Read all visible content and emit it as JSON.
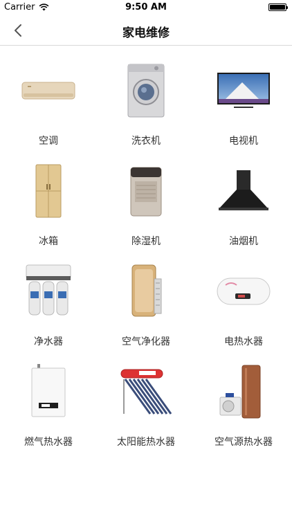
{
  "status": {
    "carrier": "Carrier",
    "time": "9:50 AM"
  },
  "nav": {
    "title": "家电维修",
    "back_icon": "chevron-left-icon"
  },
  "items": [
    {
      "label": "空调",
      "icon": "air-conditioner-icon"
    },
    {
      "label": "洗衣机",
      "icon": "washing-machine-icon"
    },
    {
      "label": "电视机",
      "icon": "television-icon"
    },
    {
      "label": "冰箱",
      "icon": "refrigerator-icon"
    },
    {
      "label": "除湿机",
      "icon": "dehumidifier-icon"
    },
    {
      "label": "油烟机",
      "icon": "range-hood-icon"
    },
    {
      "label": "净水器",
      "icon": "water-purifier-icon"
    },
    {
      "label": "空气净化器",
      "icon": "air-purifier-icon"
    },
    {
      "label": "电热水器",
      "icon": "electric-water-heater-icon"
    },
    {
      "label": "燃气热水器",
      "icon": "gas-water-heater-icon"
    },
    {
      "label": "太阳能热水器",
      "icon": "solar-water-heater-icon"
    },
    {
      "label": "空气源热水器",
      "icon": "heat-pump-water-heater-icon"
    }
  ]
}
